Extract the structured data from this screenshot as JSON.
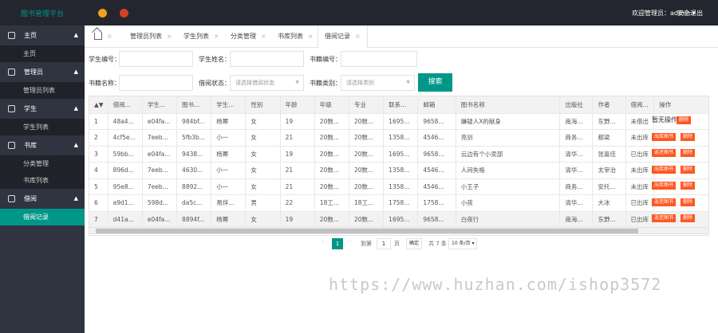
{
  "header": {
    "logo": "图书管理平台",
    "user": "欢迎管理员：admin ▾",
    "logout": "安全退出"
  },
  "sidebar": [
    {
      "label": "主页",
      "subs": [
        "主页"
      ]
    },
    {
      "label": "管理员",
      "subs": [
        "管理员列表"
      ]
    },
    {
      "label": "学生",
      "subs": [
        "学生列表"
      ]
    },
    {
      "label": "书库",
      "subs": [
        "分类管理",
        "书库列表"
      ]
    },
    {
      "label": "借阅",
      "subs": [
        "借阅记录"
      ]
    }
  ],
  "tabs": [
    "管理员列表",
    "学生列表",
    "分类管理",
    "书库列表",
    "借阅记录"
  ],
  "tab_close": "×",
  "form": {
    "student_no": "学生编号：",
    "student_name": "学生姓名：",
    "book_no": "书籍编号：",
    "book_name": "书籍名称：",
    "borrow_status": "借阅状态：",
    "status_placeholder": "请选择借阅状态",
    "book_category": "书籍类别：",
    "category_placeholder": "请选择类别",
    "search": "搜索"
  },
  "table": {
    "headers": [
      "",
      "借阅...",
      "学生...",
      "图书...",
      "学生...",
      "性别",
      "年龄",
      "年级",
      "专业",
      "联系...",
      "邮箱",
      "图书名称",
      "出版社",
      "作者",
      "借阅...",
      "操作"
    ],
    "rows": [
      [
        "1",
        "48a4...",
        "e04fa...",
        "984bf...",
        "杨幂",
        "女",
        "19",
        "20数...",
        "20数...",
        "1695...",
        "9658...",
        "嫌疑人X的献身",
        "南海...",
        "东野...",
        "未借出"
      ],
      [
        "2",
        "4cf5e...",
        "7eeb...",
        "5fb3b...",
        "小一",
        "女",
        "21",
        "20数...",
        "20数...",
        "1358...",
        "4546...",
        "亮剑",
        "商务...",
        "都梁",
        "未出库"
      ],
      [
        "3",
        "59bb...",
        "e04fa...",
        "9438...",
        "杨幂",
        "女",
        "19",
        "20数...",
        "20数...",
        "1695...",
        "9658...",
        "云边有个小卖部",
        "清华...",
        "张嘉佳",
        "已出库"
      ],
      [
        "4",
        "896d...",
        "7eeb...",
        "4630...",
        "小一",
        "女",
        "21",
        "20数...",
        "20数...",
        "1358...",
        "4546...",
        "人间失格",
        "清华...",
        "太宰治",
        "未出库"
      ],
      [
        "5",
        "95e8...",
        "7eeb...",
        "8892...",
        "小一",
        "女",
        "21",
        "20数...",
        "20数...",
        "1358...",
        "4546...",
        "小王子",
        "商务...",
        "安托...",
        "未出库"
      ],
      [
        "6",
        "a9d1...",
        "598d...",
        "da5c...",
        "易烊...",
        "男",
        "22",
        "18工...",
        "18工...",
        "1758...",
        "1758...",
        "小孩",
        "清华...",
        "大冰",
        "已出库"
      ],
      [
        "7",
        "d41a...",
        "e04fa...",
        "8894f...",
        "杨幂",
        "女",
        "19",
        "20数...",
        "20数...",
        "1695...",
        "9658...",
        "白夜行",
        "南海...",
        "东野...",
        "已出库"
      ]
    ],
    "ops": [
      [
        "暂无操作",
        "删除"
      ],
      [
        "出库图书",
        "删除"
      ],
      [
        "返还图书",
        "删除"
      ],
      [
        "出库图书",
        "删除"
      ],
      [
        "出库图书",
        "删除"
      ],
      [
        "返还图书",
        "删除"
      ],
      [
        "返还图书",
        "删除"
      ]
    ]
  },
  "pager": {
    "prev": "‹",
    "page": "1",
    "next": "›",
    "goto": "到第",
    "goto_value": "1",
    "page_unit": "页",
    "confirm": "确定",
    "total": "共 7 条",
    "per_page": "10 条/页 ▾"
  },
  "watermark": "https://www.huzhan.com/ishop3572"
}
